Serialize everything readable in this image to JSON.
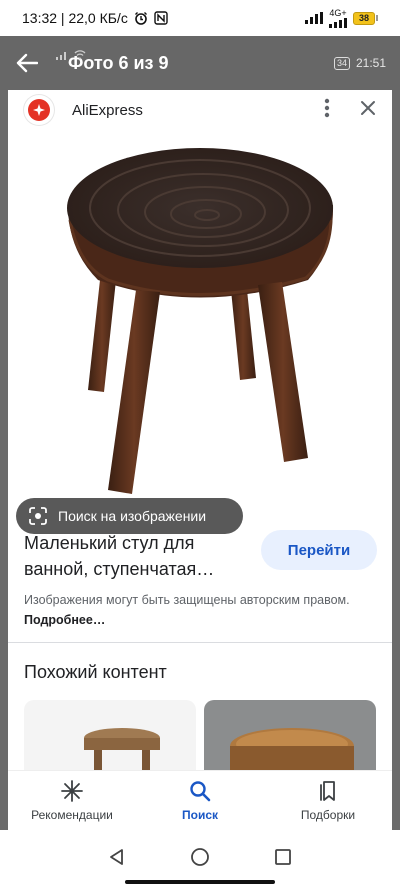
{
  "status_bar": {
    "time_speed": "13:32 | 22,0 КБ/с",
    "network": "4G+",
    "battery": "38"
  },
  "gallery_header": {
    "title": "Фото 6 из 9",
    "badge": "34",
    "time": "21:51"
  },
  "source": {
    "name": "AliExpress"
  },
  "image": {
    "lens_label": "Поиск на изображении"
  },
  "product": {
    "title": "Маленький стул для ванной, ступенчатая…",
    "go_label": "Перейти",
    "copyright_text": "Изображения могут быть защищены авторским правом.",
    "more_label": "Подробнее…"
  },
  "similar": {
    "title": "Похожий контент"
  },
  "bottom_nav": {
    "items": [
      {
        "label": "Рекомендации",
        "icon": "asterisk-icon"
      },
      {
        "label": "Поиск",
        "icon": "search-icon"
      },
      {
        "label": "Подборки",
        "icon": "collections-icon"
      }
    ],
    "active": "Поиск"
  },
  "colors": {
    "accent": "#1a57c5",
    "header_bg": "#676767",
    "ali_red": "#e43225"
  }
}
